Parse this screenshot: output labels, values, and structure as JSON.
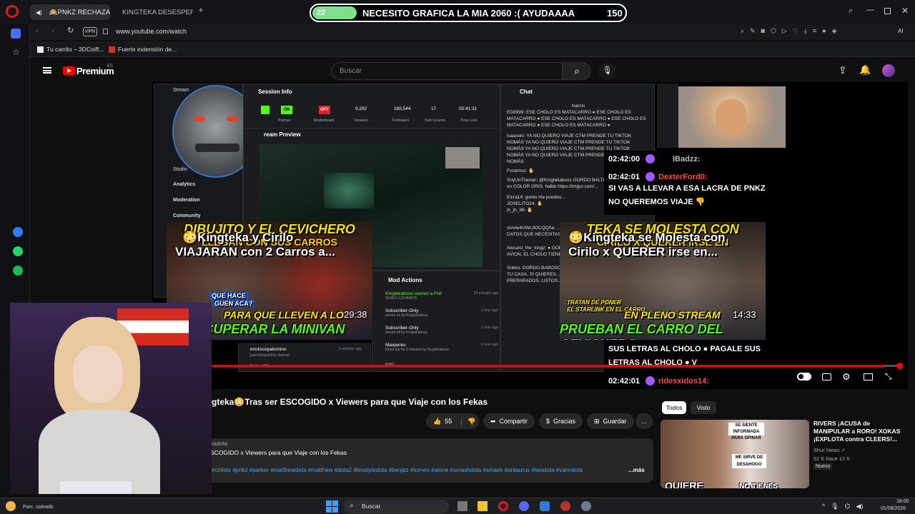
{
  "browser": {
    "tabs": [
      {
        "label": "🙉PNKZ RECHAZA G"
      },
      {
        "label": "KINGTEKA DESESPERADO"
      }
    ],
    "add_tab": "+",
    "vpn_label": "VPN",
    "url": "www.youtube.com/watch",
    "ai_label": "AI",
    "bookmarks": [
      "Tu carrito – 3DCoiff...",
      "Fuerte extensión de..."
    ]
  },
  "overlay_goal": {
    "current": "22",
    "text": "NECESITO GRAFICA LA MIA 2060 :( AYUDAAAA",
    "target": "150",
    "progress": 0.15
  },
  "youtube": {
    "logo": "Premium",
    "region": "ES",
    "search_placeholder": "Buscar"
  },
  "dashboard": {
    "menu": [
      "Stream",
      "Studio",
      "Analytics",
      "Moderation",
      "Community"
    ],
    "session_info": "Session Info",
    "badges": [
      "ON",
      "OFF"
    ],
    "stat_labels": [
      "Partner",
      "Multistream",
      "Viewers",
      "Followers",
      "Sub Counts",
      "Time Live"
    ],
    "stats": [
      "9,292",
      "165,544",
      "17",
      "02:41:31"
    ],
    "stream_preview": "ream Preview",
    "chat_title": "Chat",
    "chat_lines": [
      "Isacris",
      "ED8999: ESE CHOLO ES MATACARRO ● ESE CHOLO ES",
      "MATACARRO ● ESE CHOLO ES MATACARRO ● ESE CHOLO ES",
      "MATACARRO ● ESE CHOLO ES MATACARRO ●",
      "isaacelo: YA NO QUIERO VIAJE CTM PRENDE TU TIKTOK",
      "NOMÁS YA NO QUIERO VIAJE CTM PRENDE TU TIKTOK",
      "NOMÁS YA NO QUIERO VIAJE CTM PRENDE TU TIKTOK",
      "NOMÁS YA NO QUIERO VIAJE CTM PRENDE TU TIKTOK",
      "NOMÁS",
      "Frostmsc: ✋",
      "SoyUnTherian: @Kingtekaboss GORDO BALTAZAR",
      "en COLOR GRIS, halbe https://imgur.com/...",
      "Elcra14: gordo me puedes...",
      "JOSELITO24: ✋",
      "jh_jh_96: ✋",
      "sivviw4UWL9OCQQ0a: ...",
      "DATOS QUE NECESITAS...",
      "Alucard_the_kingz: ● GORDO",
      "AVION, EL CHOLO TIENE...",
      "Sokko: GORDO BABOSO...",
      "TU CASA, SI QUIERES...",
      "PREPARADOS, LISTOS..."
    ],
    "mod_actions": "Mod Actions",
    "mod_rows": [
      {
        "text": "Kingtekaboss started a Poll",
        "sub": "QUIEN LLEVAMOS",
        "time": "35 minutes ago"
      },
      {
        "text": "Subscriber-Only",
        "sub": "turned on by Kingtekaboss",
        "time": "1 hour ago"
      },
      {
        "text": "Subscriber-Only",
        "sub": "turned off by Kingtekaboss",
        "time": "1 hour ago"
      },
      {
        "text": "Maxperes",
        "sub": "timed out for 5 minutes by Kingtekaboss",
        "time": "1 hour ago"
      }
    ],
    "follower": {
      "name": "ericksonpalomino",
      "sub": "just followed the channel",
      "time": "5 minutes ago"
    },
    "misc_user": "DxYnar111",
    "misc_user2": "ifo80"
  },
  "big_chat": [
    {
      "time": "02:42:00",
      "user": "IBadzz:"
    },
    {
      "time": "02:42:01",
      "user": "DexterFord0:",
      "msg": "SI VAS A LLEVAR A ESA LACRA DE PNKZ NO QUEREMOS VIAJE 👎"
    },
    {
      "msg": "SUS LETRAS AL CHOLO ● PAGALE SUS LETRAS AL CHOLO ● V"
    },
    {
      "time": "02:42:01",
      "user": "ridesxidos14:"
    }
  ],
  "thumbs": [
    {
      "title_line1": "😳Kingteka y Cirilo",
      "title_line2": "VIAJARAN con 2 Carros a...",
      "overlay_top": "DIBUJITO Y EL CEVICHERO",
      "overlay_mid": "LLEGAN CON SUS CARROS",
      "caption1": "QUE HACE",
      "caption2": "GUEN ACA?",
      "overlay_bottom1": "PARA QUE LLEVEN A LO",
      "overlay_bottom2": "A RECUPERAR LA MINIVAN",
      "duration": "29:38"
    },
    {
      "title_line1": "😳Kingteka se Molesta con",
      "title_line2": "Cirilo x QUERER irse en...",
      "overlay_top": "TEKA SE MOLESTA CON",
      "overlay_mid": "CIRILO X QUERER IRSE EN",
      "caption1": "TRATAN DE PONER",
      "caption2": "EL STARLINK EN EL CARRO",
      "overlay_bottom1": "EN PLENO STREAM",
      "overlay_bottom2": "PRUEBAN EL CARRO DEL CEVICHERO",
      "duration": "14:33"
    }
  ],
  "video": {
    "progress": 0.98,
    "title": "gteka😳Tras ser ESCOGIDO x Viewers para que Viaje con los Fekas",
    "likes": "55",
    "share": "Compartir",
    "thanks": "Gracias",
    "save": "Guardar",
    "more": "...",
    "channel_tail": "kadota",
    "desc_line": "SCOGIDO x Viewers para que Viaje con los Fekas",
    "hashtags": "#cirilotv #pnkz #parker #matthewdota #matthew #dota2 #leostyledota #benjaz #torneo #alone #smashdota #smash #antaurus #iwodota #vanndota",
    "desc_more": "...más"
  },
  "side": {
    "chips": [
      "Todos",
      "Visto"
    ],
    "rec": {
      "title": "RIVERS ¡ACUSA de MANIPULAR a RORO! XOKAS ¡EXPLOTA contra CLEERS!...",
      "channel": "Shur News ✓",
      "meta": "52 K hace 12 h",
      "badge": "Nuevo",
      "thumb_text1": "SE SIENTE INFORMADA PARA OPINAR",
      "thumb_text2": "ME SIRVE DE DESAHOGO",
      "thumb_text3": "QUIERE",
      "thumb_text4": "NO TIENES"
    }
  },
  "taskbar": {
    "weather": "Parc. soleado",
    "search": "Buscar",
    "time": "18:00",
    "date": "01/08/2026"
  },
  "colors": {
    "yt_red": "#ff0000",
    "accent_green": "#53fc18",
    "bg": "#0f0f0f"
  }
}
